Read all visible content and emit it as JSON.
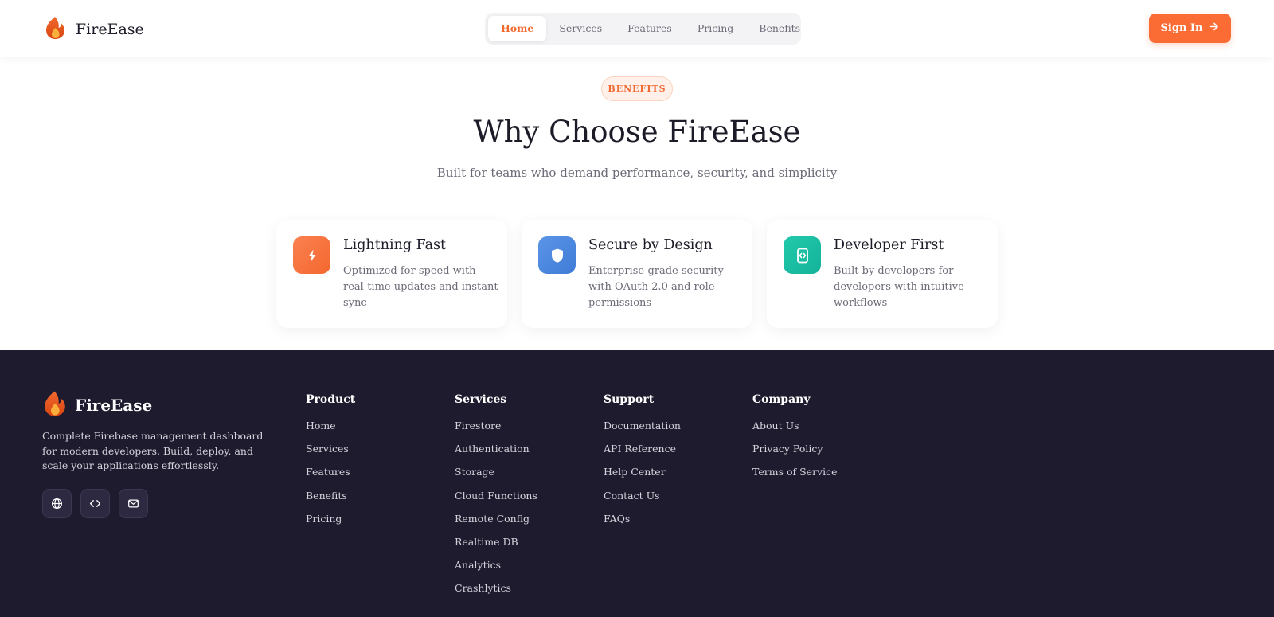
{
  "header": {
    "brand": "FireEase",
    "nav": [
      "Home",
      "Services",
      "Features",
      "Pricing",
      "Benefits"
    ],
    "active_nav": "Home",
    "signin_label": "Sign In"
  },
  "benefits": {
    "badge": "BENEFITS",
    "title": "Why Choose FireEase",
    "subtitle": "Built for teams who demand performance, security, and simplicity",
    "cards": [
      {
        "title": "Lightning Fast",
        "description": "Optimized for speed with real-time updates and instant sync",
        "icon": "lightning-icon",
        "color": "#fb7a45"
      },
      {
        "title": "Secure by Design",
        "description": "Enterprise-grade security with OAuth 2.0 and role permissions",
        "icon": "shield-icon",
        "color": "#4f8be0"
      },
      {
        "title": "Developer First",
        "description": "Built by developers for developers with intuitive workflows",
        "icon": "code-icon",
        "color": "#1cbfa0"
      }
    ]
  },
  "footer": {
    "brand": "FireEase",
    "description": "Complete Firebase management dashboard for modern developers. Build, deploy, and scale your applications effortlessly.",
    "socials": [
      "globe-icon",
      "code-icon",
      "mail-icon"
    ],
    "columns": [
      {
        "title": "Product",
        "links": [
          "Home",
          "Services",
          "Features",
          "Benefits",
          "Pricing"
        ]
      },
      {
        "title": "Services",
        "links": [
          "Firestore",
          "Authentication",
          "Storage",
          "Cloud Functions",
          "Remote Config",
          "Realtime DB",
          "Analytics",
          "Crashlytics"
        ]
      },
      {
        "title": "Support",
        "links": [
          "Documentation",
          "API Reference",
          "Help Center",
          "Contact Us",
          "FAQs"
        ]
      },
      {
        "title": "Company",
        "links": [
          "About Us",
          "Privacy Policy",
          "Terms of Service"
        ]
      }
    ]
  },
  "colors": {
    "accent": "#fb6c34",
    "footer_bg": "#1e1b2e"
  }
}
